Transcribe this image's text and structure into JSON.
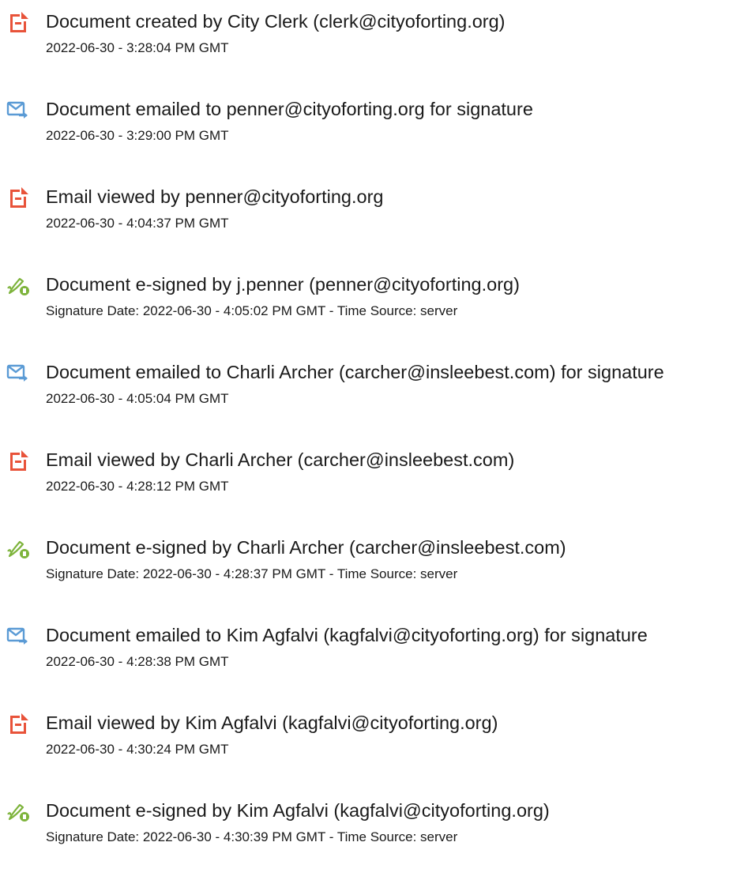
{
  "colors": {
    "document_icon": "#e8533a",
    "email_icon": "#5b9bd5",
    "signature_icon": "#7db33b",
    "text": "#1a1a1a"
  },
  "events": [
    {
      "icon": "document-icon",
      "title": "Document created by City Clerk (clerk@cityoforting.org)",
      "time": "2022-06-30 - 3:28:04 PM GMT"
    },
    {
      "icon": "email-sent-icon",
      "title": "Document emailed to penner@cityoforting.org for signature",
      "time": "2022-06-30 - 3:29:00 PM GMT"
    },
    {
      "icon": "document-icon",
      "title": "Email viewed by penner@cityoforting.org",
      "time": "2022-06-30 - 4:04:37 PM GMT"
    },
    {
      "icon": "signature-pen-icon",
      "title": "Document e-signed by j.penner (penner@cityoforting.org)",
      "time": "Signature Date: 2022-06-30 - 4:05:02 PM GMT - Time Source: server"
    },
    {
      "icon": "email-sent-icon",
      "title": "Document emailed to Charli Archer (carcher@insleebest.com) for signature",
      "time": "2022-06-30 - 4:05:04 PM GMT"
    },
    {
      "icon": "document-icon",
      "title": "Email viewed by Charli Archer (carcher@insleebest.com)",
      "time": "2022-06-30 - 4:28:12 PM GMT"
    },
    {
      "icon": "signature-pen-icon",
      "title": "Document e-signed by Charli Archer (carcher@insleebest.com)",
      "time": "Signature Date: 2022-06-30 - 4:28:37 PM GMT - Time Source: server"
    },
    {
      "icon": "email-sent-icon",
      "title": "Document emailed to Kim Agfalvi (kagfalvi@cityoforting.org) for signature",
      "time": "2022-06-30 - 4:28:38 PM GMT"
    },
    {
      "icon": "document-icon",
      "title": "Email viewed by Kim Agfalvi (kagfalvi@cityoforting.org)",
      "time": "2022-06-30 - 4:30:24 PM GMT"
    },
    {
      "icon": "signature-pen-icon",
      "title": "Document e-signed by Kim Agfalvi (kagfalvi@cityoforting.org)",
      "time": "Signature Date: 2022-06-30 - 4:30:39 PM GMT - Time Source: server"
    }
  ]
}
